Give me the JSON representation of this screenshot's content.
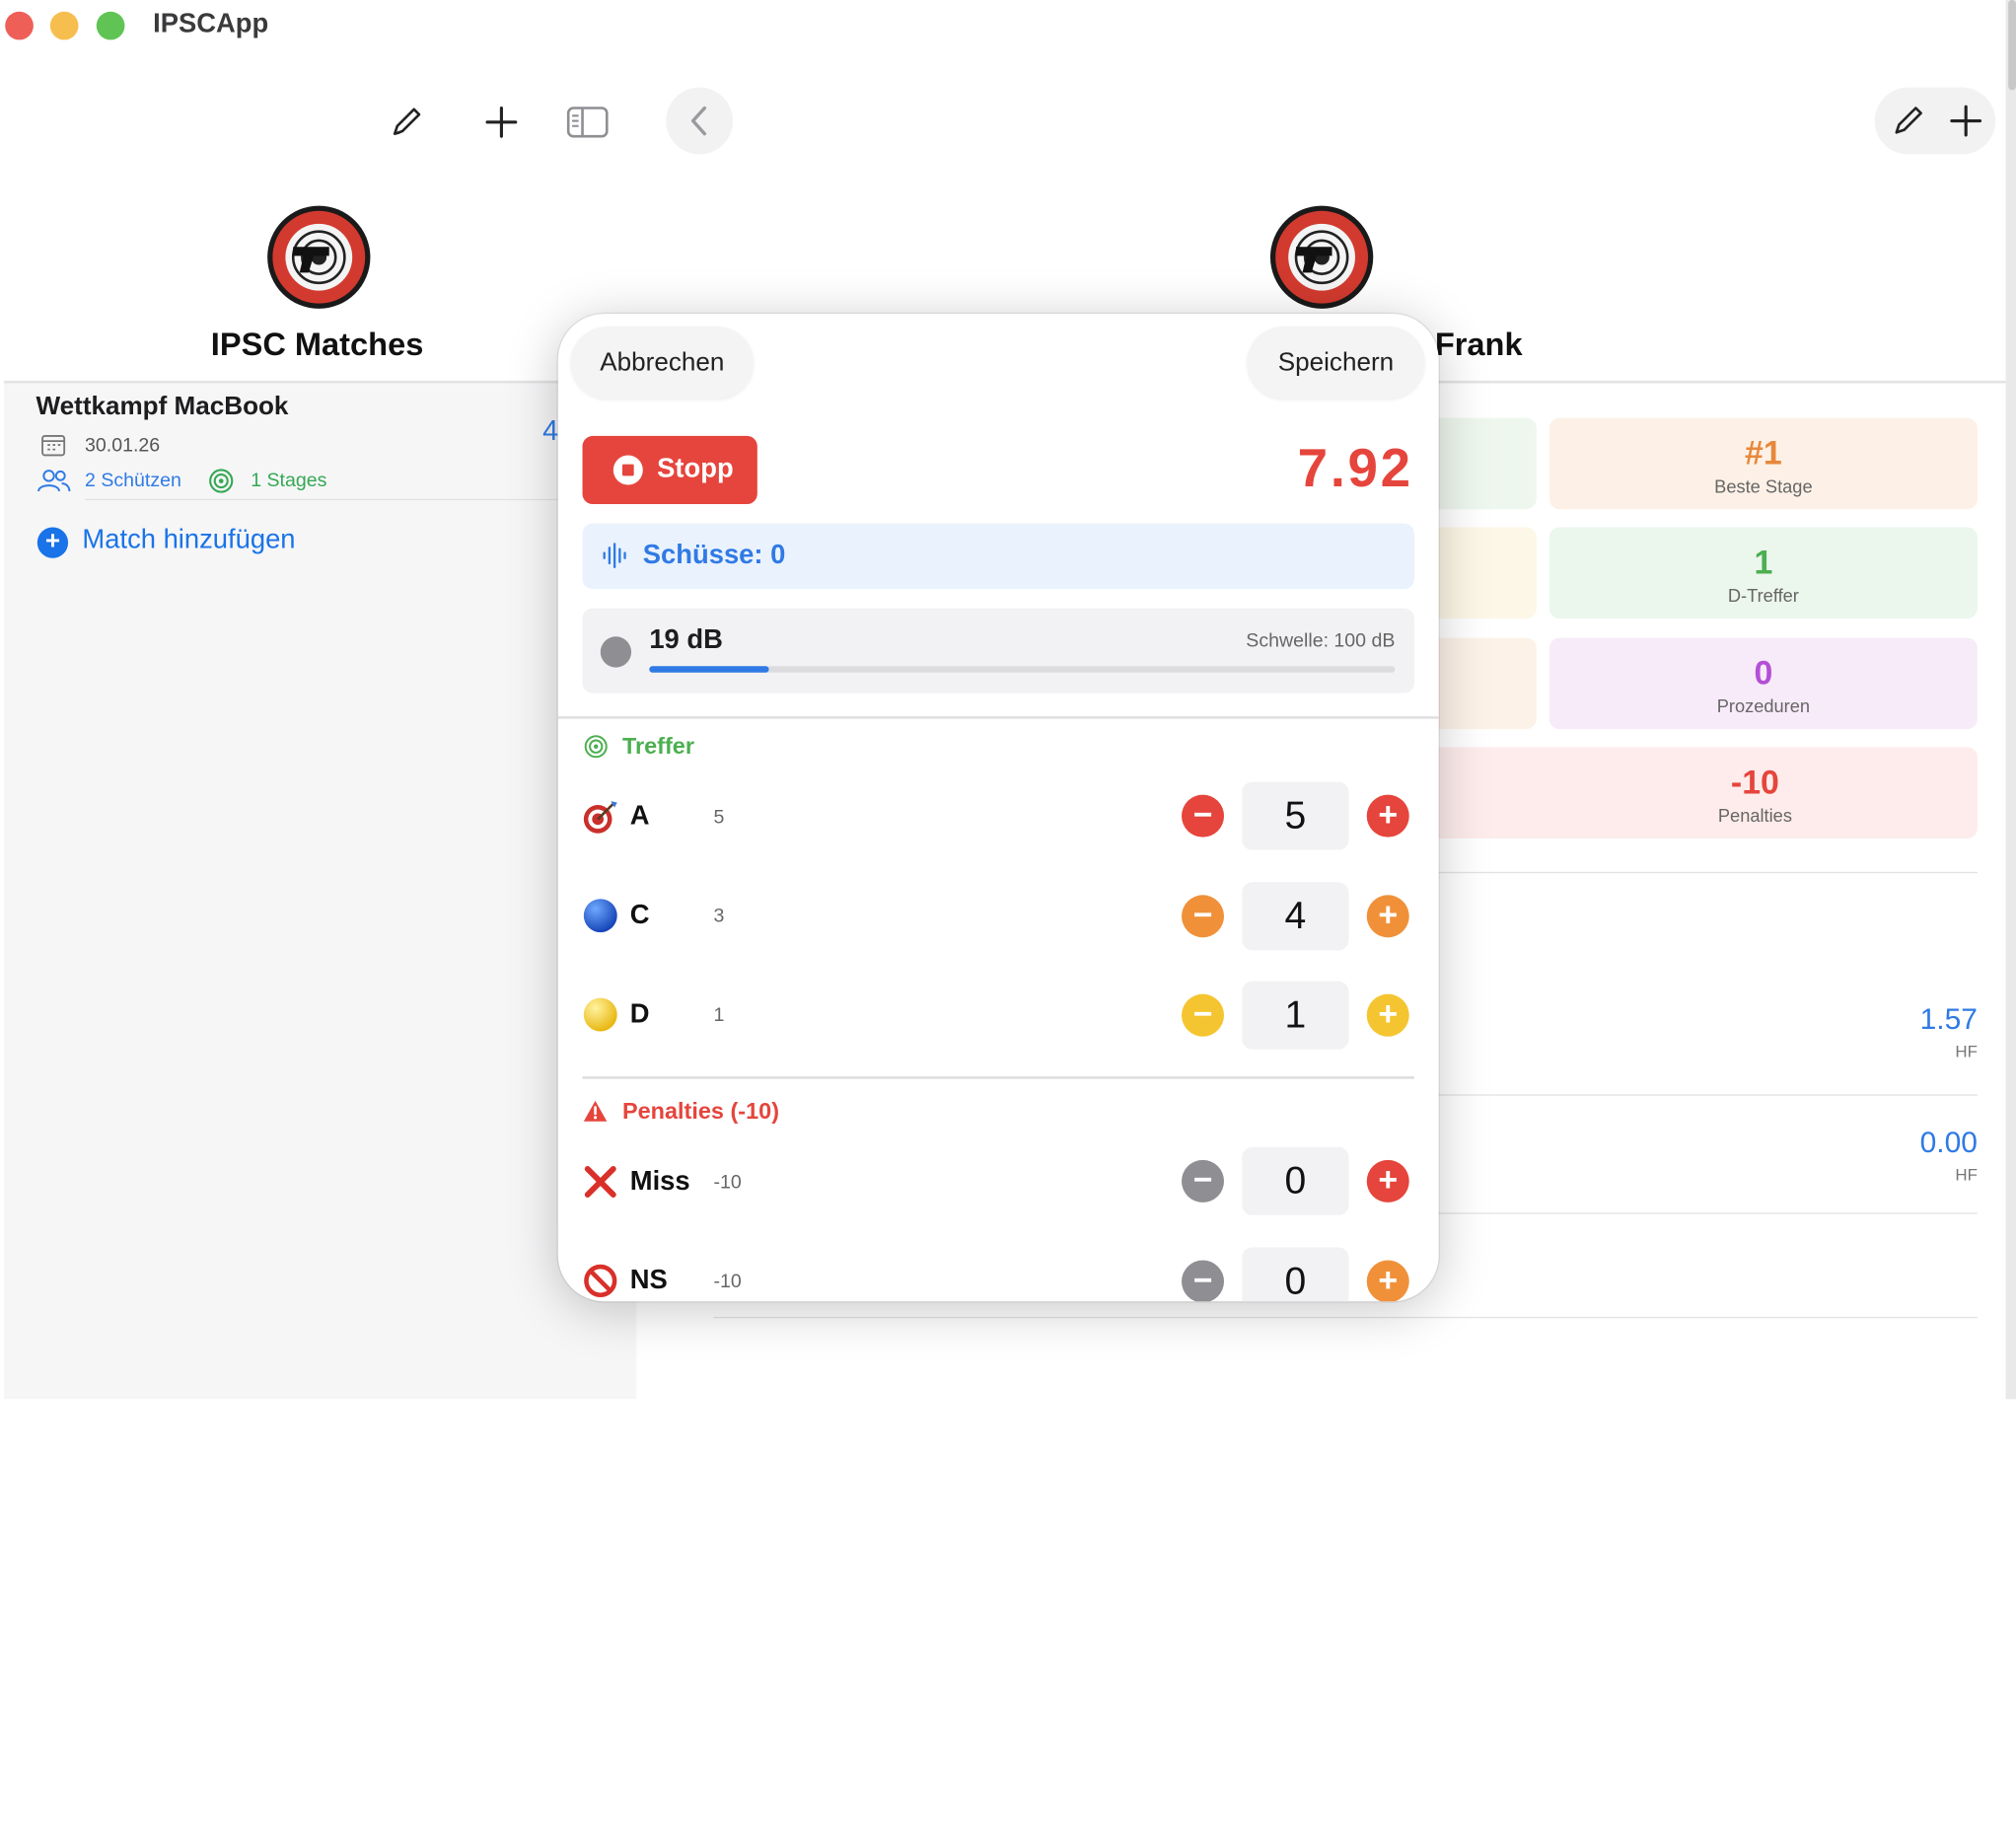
{
  "app": {
    "title": "IPSCApp"
  },
  "sidebar": {
    "title": "IPSC Matches",
    "matches": [
      {
        "name": "Wettkampf MacBook",
        "date": "30.01.26",
        "shooters": "2 Schützen",
        "stages": "1 Stages",
        "count": "4"
      }
    ],
    "add_match_label": "Match hinzufügen"
  },
  "detail": {
    "title_suffix": "Frank",
    "stats": [
      {
        "value": "#1",
        "label": "Beste Stage",
        "color": "#e8883a"
      },
      {
        "value": "1",
        "label": "D-Treffer",
        "color": "#4caf50"
      },
      {
        "value": "0",
        "label": "Prozeduren",
        "color": "#b44fd6"
      },
      {
        "value": "-10",
        "label": "Penalties",
        "color": "#e5453c"
      }
    ],
    "hf_rows": [
      {
        "value": "1.57",
        "label": "HF"
      },
      {
        "value": "0.00",
        "label": "HF"
      }
    ]
  },
  "modal": {
    "cancel_label": "Abbrechen",
    "save_label": "Speichern",
    "stop_label": "Stopp",
    "timer": "7.92",
    "shots_label": "Schüsse: 0",
    "db_value": "19 dB",
    "db_threshold": "Schwelle: 100 dB",
    "db_level": 0.16,
    "hits_section": "Treffer",
    "hits": [
      {
        "zone": "A",
        "points": "5",
        "count": "5",
        "icon": "target-dart-icon"
      },
      {
        "zone": "C",
        "points": "3",
        "count": "4",
        "icon": "blue-circle-icon"
      },
      {
        "zone": "D",
        "points": "1",
        "count": "1",
        "icon": "yellow-circle-icon"
      }
    ],
    "penalties_section": "Penalties (-10)",
    "penalties": [
      {
        "zone": "Miss",
        "points": "-10",
        "count": "0",
        "icon": "red-x-icon"
      },
      {
        "zone": "NS",
        "points": "-10",
        "count": "0",
        "icon": "no-entry-icon"
      }
    ]
  },
  "colors": {
    "accent": "#2f7ae5",
    "stop": "#e5453c",
    "orange": "#f0913a",
    "yellow": "#f5c531",
    "gray": "#8e8e93"
  }
}
